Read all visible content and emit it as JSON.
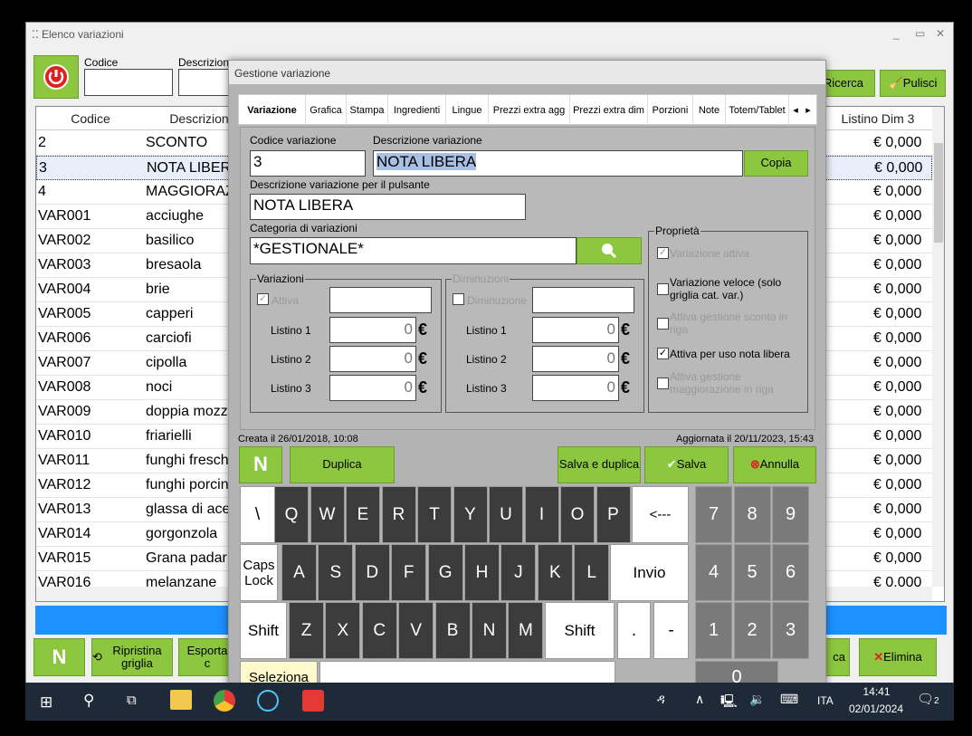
{
  "outer": {
    "title": "Elenco variazioni",
    "codice_label": "Codice",
    "descrizione_label": "Descrizion",
    "ricerca": "Ricerca",
    "pulisci": "Pulisci",
    "new": "N",
    "ripristina": "Ripristina griglia",
    "esporta": "Esporta c",
    "elimina": "Elimina",
    "ca": "ca"
  },
  "grid": {
    "headers": [
      "Codice",
      "Descrizion",
      "Listino Dim 3"
    ],
    "rows": [
      {
        "code": "2",
        "desc": "SCONTO",
        "price": "€ 0,000"
      },
      {
        "code": "3",
        "desc": "NOTA LIBER",
        "price": "€ 0,000"
      },
      {
        "code": "4",
        "desc": "MAGGIORAZ",
        "price": "€ 0,000"
      },
      {
        "code": "VAR001",
        "desc": "acciughe",
        "price": "€ 0,000"
      },
      {
        "code": "VAR002",
        "desc": "basilico",
        "price": "€ 0,000"
      },
      {
        "code": "VAR003",
        "desc": "bresaola",
        "price": "€ 0,000"
      },
      {
        "code": "VAR004",
        "desc": "brie",
        "price": "€ 0,000"
      },
      {
        "code": "VAR005",
        "desc": "capperi",
        "price": "€ 0,000"
      },
      {
        "code": "VAR006",
        "desc": "carciofi",
        "price": "€ 0,000"
      },
      {
        "code": "VAR007",
        "desc": "cipolla",
        "price": "€ 0,000"
      },
      {
        "code": "VAR008",
        "desc": "noci",
        "price": "€ 0,000"
      },
      {
        "code": "VAR009",
        "desc": "doppia mozz",
        "price": "€ 0,000"
      },
      {
        "code": "VAR010",
        "desc": "friarielli",
        "price": "€ 0,000"
      },
      {
        "code": "VAR011",
        "desc": "funghi fresch",
        "price": "€ 0,000"
      },
      {
        "code": "VAR012",
        "desc": "funghi porcin",
        "price": "€ 0,000"
      },
      {
        "code": "VAR013",
        "desc": "glassa di ace",
        "price": "€ 0,000"
      },
      {
        "code": "VAR014",
        "desc": "gorgonzola",
        "price": "€ 0,000"
      },
      {
        "code": "VAR015",
        "desc": "Grana padar",
        "price": "€ 0,000"
      },
      {
        "code": "VAR016",
        "desc": "melanzane",
        "price": "€ 0.000"
      }
    ]
  },
  "dialog": {
    "title": "Gestione variazione",
    "tabs": [
      "Variazione",
      "Grafica",
      "Stampa",
      "Ingredienti",
      "Lingue",
      "Prezzi extra agg",
      "Prezzi extra dim",
      "Porzioni",
      "Note",
      "Totem/Tablet"
    ],
    "codice_label": "Codice variazione",
    "codice_value": "3",
    "desc_label": "Descrizione variazione",
    "desc_value": "NOTA LIBERA",
    "copia": "Copia",
    "pulsante_label": "Descrizione variazione per il pulsante",
    "pulsante_value": "NOTA LIBERA",
    "categoria_label": "Categoria di variazioni",
    "categoria_value": "*GESTIONALE*",
    "variazioni": {
      "legend": "Variazioni",
      "attiva": "Attiva",
      "l1": "Listino 1",
      "l2": "Listino 2",
      "l3": "Listino 3",
      "v1": "0",
      "v2": "0",
      "v3": "0"
    },
    "diminuzioni": {
      "legend": "Diminuzioni",
      "diminuzione": "Diminuzione",
      "l1": "Listino 1",
      "l2": "Listino 2",
      "l3": "Listino 3",
      "v1": "0",
      "v2": "0",
      "v3": "0"
    },
    "euro": "€",
    "proprieta": {
      "legend": "Proprietà",
      "p1": "Variazione attiva",
      "p2": "Variazione veloce (solo griglia cat. var.)",
      "p3": "Attiva gestione sconto in riga",
      "p4": "Attiva per uso nota libera",
      "p5": "Attiva gestione maggiorazione in riga"
    },
    "created": "Creata il 26/01/2018, 10:08",
    "updated": "Aggiornata il 20/11/2023, 15:43",
    "new": "N",
    "duplica": "Duplica",
    "salva_duplica": "Salva e duplica",
    "salva": "Salva",
    "annulla": "Annulla"
  },
  "keyboard": {
    "row1": [
      "\\",
      "Q",
      "W",
      "E",
      "R",
      "T",
      "Y",
      "U",
      "I",
      "O",
      "P",
      "<---"
    ],
    "row2": [
      "Caps Lock",
      "A",
      "S",
      "D",
      "F",
      "G",
      "H",
      "J",
      "K",
      "L",
      "Invio"
    ],
    "row3": [
      "Shift",
      "Z",
      "X",
      "C",
      "V",
      "B",
      "N",
      "M",
      "Shift",
      ".",
      "-"
    ],
    "seleziona": "Seleziona",
    "numpad": [
      "7",
      "8",
      "9",
      "4",
      "5",
      "6",
      "1",
      "2",
      "3",
      "0"
    ]
  },
  "taskbar": {
    "lang": "ITA",
    "time": "14:41",
    "date": "02/01/2024",
    "notif": "2"
  }
}
